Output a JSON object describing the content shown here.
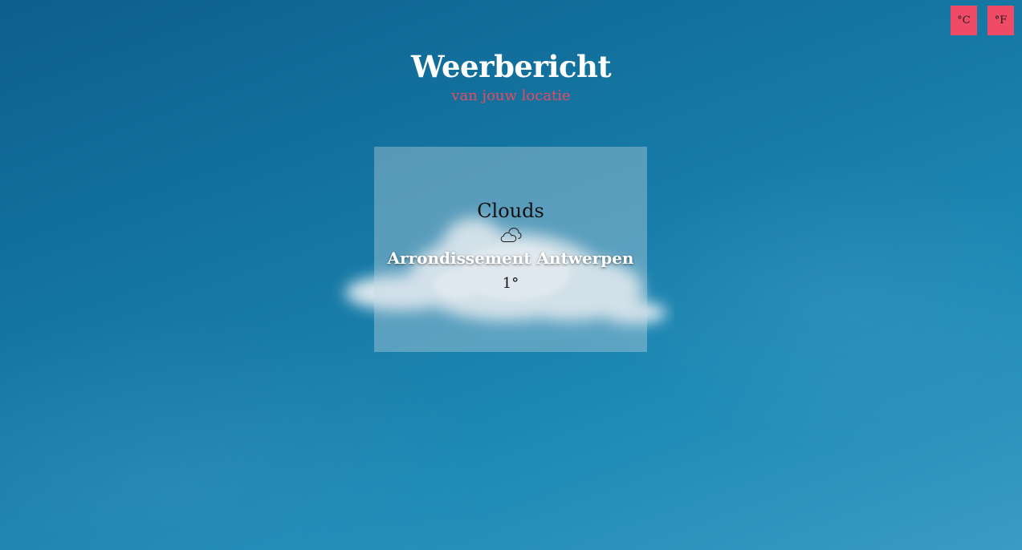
{
  "units": {
    "celsius_label": "°C",
    "fahrenheit_label": "°F"
  },
  "header": {
    "title": "Weerbericht",
    "subtitle": "van jouw locatie"
  },
  "weather": {
    "condition": "Clouds",
    "icon": "cloud-icon",
    "location": "Arrondissement Antwerpen",
    "temperature": "1°"
  },
  "colors": {
    "accent": "#ef4b66",
    "subtitle": "#e84a63",
    "sky": "#1474a0"
  }
}
